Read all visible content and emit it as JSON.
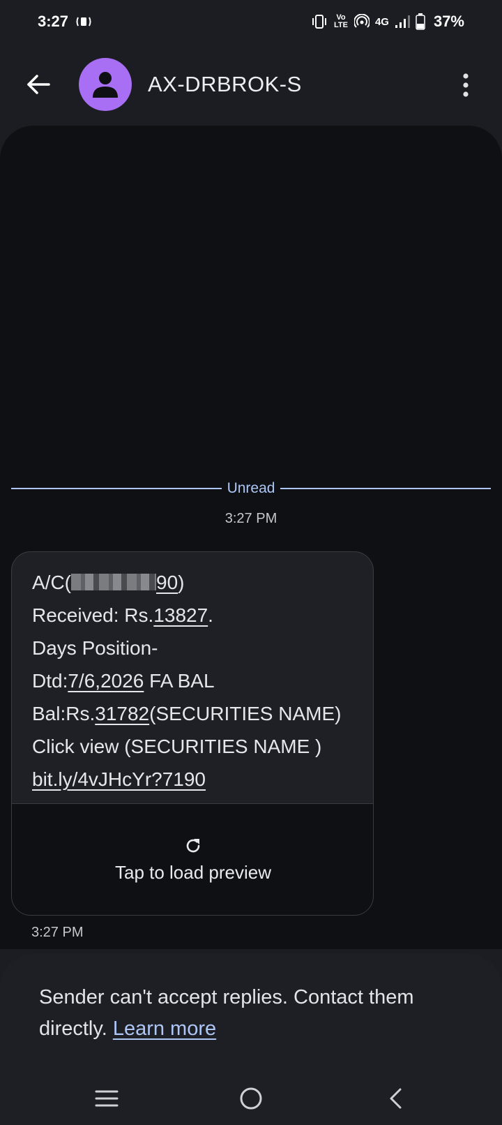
{
  "status_bar": {
    "time": "3:27",
    "volte_label": "Vo LTE",
    "network": "4G",
    "battery": "37%"
  },
  "header": {
    "title": "AX-DRBROK-S",
    "avatar_color": "#a86ef3"
  },
  "conversation": {
    "unread_label": "Unread",
    "divider_time": "3:27 PM",
    "message": {
      "acct_prefix": "A/C(",
      "acct_suffix": "90",
      "acct_close": ")",
      "received_prefix": "Received: Rs.",
      "received_amount": "13827",
      "received_suffix": ".",
      "line_days": "Days Position-",
      "dtd_prefix": "Dtd:",
      "dtd_date": "7/6,2026",
      "dtd_suffix": " FA BAL",
      "bal_prefix": "Bal:Rs.",
      "bal_amount": "31782",
      "bal_suffix": "(SECURITIES NAME)",
      "click_line": "Click view (SECURITIES NAME )",
      "link": "bit.ly/4vJHcYr?7190",
      "preview_label": "Tap to load preview",
      "time": "3:27 PM"
    }
  },
  "notice": {
    "text": "Sender can't accept replies. Contact them directly. ",
    "learn_more": "Learn more"
  },
  "colors": {
    "accent": "#aec6f6",
    "background": "#1c1d22",
    "conversation_bg": "#0f1014"
  }
}
